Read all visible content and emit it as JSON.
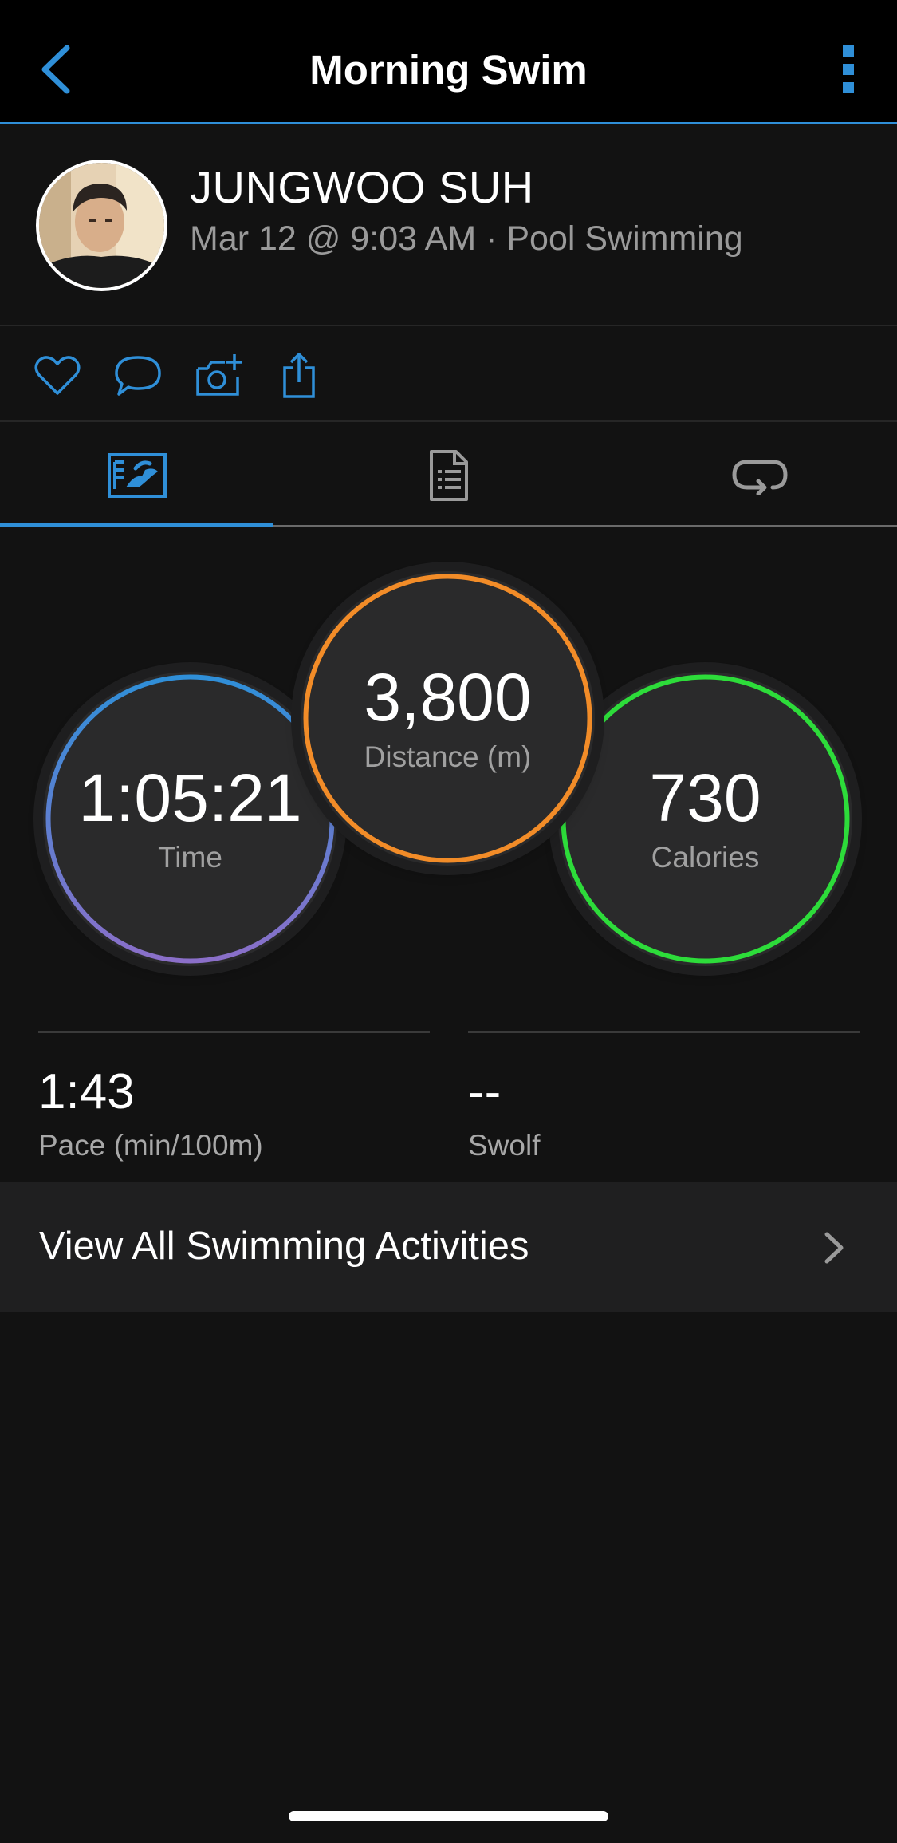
{
  "nav": {
    "title": "Morning Swim",
    "back_icon": "chevron-left-icon",
    "more_icon": "vertical-ellipsis-icon",
    "accent": "#2f8fd8"
  },
  "profile": {
    "name": "JUNGWOO SUH",
    "meta": "Mar 12 @ 9:03 AM · Pool Swimming"
  },
  "actions": [
    {
      "icon": "heart-icon"
    },
    {
      "icon": "comment-icon"
    },
    {
      "icon": "add-photo-icon"
    },
    {
      "icon": "share-icon"
    }
  ],
  "tabs": [
    {
      "icon": "stats-tab-icon",
      "active": true
    },
    {
      "icon": "details-tab-icon",
      "active": false
    },
    {
      "icon": "laps-tab-icon",
      "active": false
    }
  ],
  "stats": {
    "time": {
      "value": "1:05:21",
      "label": "Time",
      "ring_colors": [
        "#2f8fd8",
        "#8b6fc9"
      ]
    },
    "distance": {
      "value": "3,800",
      "label": "Distance (m)",
      "ring_color": "#f28c28"
    },
    "calories": {
      "value": "730",
      "label": "Calories",
      "ring_color": "#2ddc3a"
    }
  },
  "secondary": {
    "pace": {
      "value": "1:43",
      "label": "Pace (min/100m)"
    },
    "swolf": {
      "value": "--",
      "label": "Swolf"
    }
  },
  "view_all": {
    "label": "View All Swimming Activities",
    "icon": "chevron-right-icon"
  }
}
